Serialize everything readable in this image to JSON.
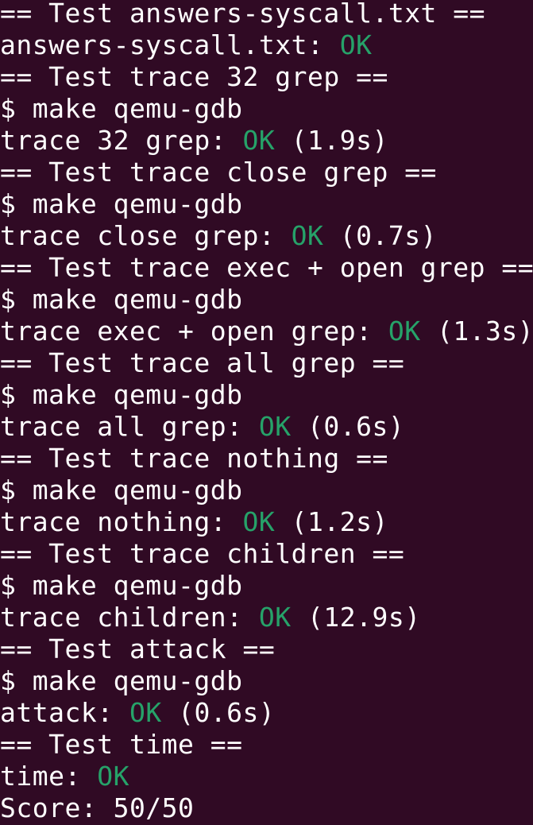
{
  "colors": {
    "background": "#300a24",
    "foreground": "#ffffff",
    "ok": "#26a269"
  },
  "lines": [
    {
      "type": "plain",
      "text": "== Test answers-syscall.txt =="
    },
    {
      "type": "result",
      "prefix": "answers-syscall.txt: ",
      "status": "OK",
      "suffix": ""
    },
    {
      "type": "plain",
      "text": "== Test trace 32 grep =="
    },
    {
      "type": "plain",
      "text": "$ make qemu-gdb"
    },
    {
      "type": "result",
      "prefix": "trace 32 grep: ",
      "status": "OK",
      "suffix": " (1.9s)"
    },
    {
      "type": "plain",
      "text": "== Test trace close grep =="
    },
    {
      "type": "plain",
      "text": "$ make qemu-gdb"
    },
    {
      "type": "result",
      "prefix": "trace close grep: ",
      "status": "OK",
      "suffix": " (0.7s)"
    },
    {
      "type": "plain",
      "text": "== Test trace exec + open grep =="
    },
    {
      "type": "plain",
      "text": "$ make qemu-gdb"
    },
    {
      "type": "result",
      "prefix": "trace exec + open grep: ",
      "status": "OK",
      "suffix": " (1.3s)"
    },
    {
      "type": "plain",
      "text": "== Test trace all grep =="
    },
    {
      "type": "plain",
      "text": "$ make qemu-gdb"
    },
    {
      "type": "result",
      "prefix": "trace all grep: ",
      "status": "OK",
      "suffix": " (0.6s)"
    },
    {
      "type": "plain",
      "text": "== Test trace nothing =="
    },
    {
      "type": "plain",
      "text": "$ make qemu-gdb"
    },
    {
      "type": "result",
      "prefix": "trace nothing: ",
      "status": "OK",
      "suffix": " (1.2s)"
    },
    {
      "type": "plain",
      "text": "== Test trace children =="
    },
    {
      "type": "plain",
      "text": "$ make qemu-gdb"
    },
    {
      "type": "result",
      "prefix": "trace children: ",
      "status": "OK",
      "suffix": " (12.9s)"
    },
    {
      "type": "plain",
      "text": "== Test attack =="
    },
    {
      "type": "plain",
      "text": "$ make qemu-gdb"
    },
    {
      "type": "result",
      "prefix": "attack: ",
      "status": "OK",
      "suffix": " (0.6s)"
    },
    {
      "type": "plain",
      "text": "== Test time =="
    },
    {
      "type": "result",
      "prefix": "time: ",
      "status": "OK",
      "suffix": ""
    },
    {
      "type": "plain",
      "text": "Score: 50/50"
    }
  ]
}
